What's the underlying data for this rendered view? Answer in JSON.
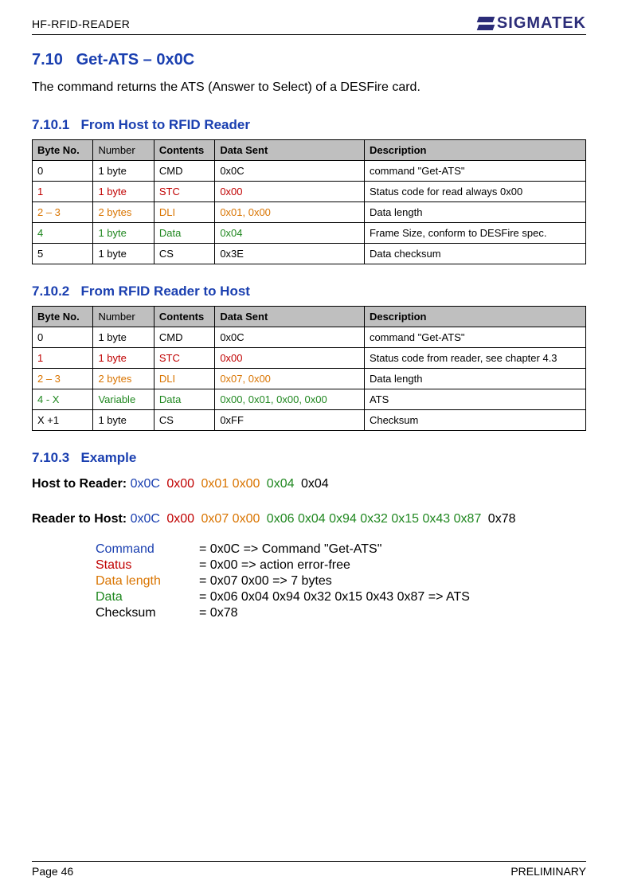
{
  "header": {
    "doc_id": "HF-RFID-READER",
    "brand": "SIGMATEK"
  },
  "section": {
    "num": "7.10",
    "title": "Get-ATS – 0x0C",
    "intro": "The command returns the ATS (Answer to Select) of a DESFire card."
  },
  "sub1": {
    "num": "7.10.1",
    "title": "From Host to RFID Reader"
  },
  "sub2": {
    "num": "7.10.2",
    "title": "From RFID Reader to Host"
  },
  "sub3": {
    "num": "7.10.3",
    "title": "Example"
  },
  "table_headers": {
    "byte_no": "Byte No.",
    "number": "Number",
    "contents": "Contents",
    "data_sent": "Data Sent",
    "description": "Description"
  },
  "table1": {
    "rows": [
      {
        "byte": "0",
        "num": "1 byte",
        "cont": "CMD",
        "sent": "0x0C",
        "desc": "command \"Get-ATS\"",
        "cls": ""
      },
      {
        "byte": "1",
        "num": "1 byte",
        "cont": "STC",
        "sent": "0x00",
        "desc": "Status code for read always 0x00",
        "cls": "c-red"
      },
      {
        "byte": "2 – 3",
        "num": "2 bytes",
        "cont": "DLI",
        "sent": "0x01, 0x00",
        "desc": "Data length",
        "cls": "c-orange"
      },
      {
        "byte": "4",
        "num": "1 byte",
        "cont": "Data",
        "sent": "0x04",
        "desc": "Frame Size, conform to DESFire spec.",
        "cls": "c-green"
      },
      {
        "byte": "5",
        "num": "1 byte",
        "cont": "CS",
        "sent": "0x3E",
        "desc": "Data checksum",
        "cls": ""
      }
    ]
  },
  "table2": {
    "rows": [
      {
        "byte": "0",
        "num": "1 byte",
        "cont": "CMD",
        "sent": "0x0C",
        "desc": "command \"Get-ATS\"",
        "cls": ""
      },
      {
        "byte": "1",
        "num": "1 byte",
        "cont": "STC",
        "sent": "0x00",
        "desc": "Status code from reader, see chapter 4.3",
        "cls": "c-red"
      },
      {
        "byte": "2 – 3",
        "num": "2 bytes",
        "cont": "DLI",
        "sent": "0x07, 0x00",
        "desc": "Data length",
        "cls": "c-orange"
      },
      {
        "byte": "4 - X",
        "num": "Variable",
        "cont": "Data",
        "sent": "0x00, 0x01, 0x00, 0x00",
        "desc": "ATS",
        "cls": "c-green"
      },
      {
        "byte": "X +1",
        "num": "1 byte",
        "cont": "CS",
        "sent": "0xFF",
        "desc": "Checksum",
        "cls": ""
      }
    ]
  },
  "example": {
    "host_to_reader_label": "Host to Reader:",
    "host_to_reader": [
      {
        "t": "0x0C",
        "c": "c-blue"
      },
      {
        "t": "0x00",
        "c": "c-red"
      },
      {
        "t": "0x01 0x00",
        "c": "c-orange"
      },
      {
        "t": "0x04",
        "c": "c-green"
      },
      {
        "t": "0x04",
        "c": ""
      }
    ],
    "reader_to_host_label": "Reader to Host:",
    "reader_to_host": [
      {
        "t": "0x0C",
        "c": "c-blue"
      },
      {
        "t": "0x00",
        "c": "c-red"
      },
      {
        "t": "0x07 0x00",
        "c": "c-orange"
      },
      {
        "t": "0x06 0x04 0x94 0x32 0x15 0x43 0x87",
        "c": "c-green"
      },
      {
        "t": "0x78",
        "c": ""
      }
    ],
    "breakdown": [
      {
        "lbl": "Command",
        "lcls": "c-blue",
        "val": "= 0x0C => Command \"Get-ATS\""
      },
      {
        "lbl": "Status",
        "lcls": "c-red",
        "val": "= 0x00 => action error-free"
      },
      {
        "lbl": "Data length",
        "lcls": "c-orange",
        "val": "= 0x07 0x00 => 7 bytes"
      },
      {
        "lbl": "Data",
        "lcls": "c-green",
        "val": "= 0x06 0x04 0x94 0x32 0x15 0x43 0x87 => ATS"
      },
      {
        "lbl": "Checksum",
        "lcls": "",
        "val": "= 0x78"
      }
    ]
  },
  "footer": {
    "page": "Page 46",
    "status": "PRELIMINARY"
  }
}
